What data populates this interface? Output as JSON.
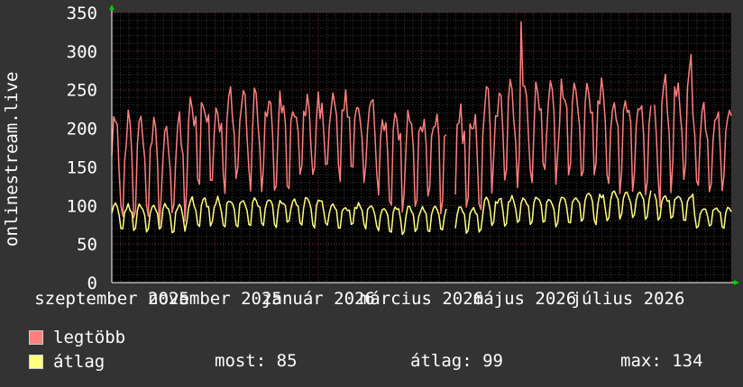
{
  "chart_data": {
    "type": "line",
    "ylabel": "onlinestream.live",
    "ylim": [
      0,
      350
    ],
    "yticks": [
      0,
      50,
      100,
      150,
      200,
      250,
      300,
      350
    ],
    "xtick_labels": [
      "szeptember 2025",
      "november 2025",
      "január 2026",
      "március 2026",
      "május 2026",
      "július 2026"
    ],
    "grid": true,
    "gaps": [
      [
        0.542,
        0.552
      ],
      [
        0.871,
        0.874
      ]
    ],
    "series": [
      {
        "name": "legtöbb",
        "color": "#ff7f7f",
        "seed": 7,
        "segments": [
          {
            "t0": 0.0,
            "t1": 0.12,
            "base": 160,
            "amp": 50,
            "spike": 20
          },
          {
            "t0": 0.12,
            "t1": 0.35,
            "base": 195,
            "amp": 45,
            "spike": 25
          },
          {
            "t0": 0.35,
            "t1": 0.43,
            "base": 200,
            "amp": 40,
            "spike": 15
          },
          {
            "t0": 0.43,
            "t1": 0.6,
            "base": 175,
            "amp": 45,
            "spike": 20
          },
          {
            "t0": 0.6,
            "t1": 0.72,
            "base": 205,
            "amp": 45,
            "spike": 25
          },
          {
            "t0": 0.72,
            "t1": 0.8,
            "base": 210,
            "amp": 45,
            "spike": 20
          },
          {
            "t0": 0.8,
            "t1": 0.88,
            "base": 195,
            "amp": 45,
            "spike": 15
          },
          {
            "t0": 0.88,
            "t1": 0.94,
            "base": 210,
            "amp": 60,
            "spike": 35
          },
          {
            "t0": 0.94,
            "t1": 1.0,
            "base": 185,
            "amp": 40,
            "spike": 15
          }
        ],
        "max_value": 338
      },
      {
        "name": "átlag",
        "color": "#ffff80",
        "seed": 3,
        "segments": [
          {
            "t0": 0.0,
            "t1": 0.12,
            "base": 88,
            "amp": 14,
            "spike": 4
          },
          {
            "t0": 0.12,
            "t1": 0.35,
            "base": 95,
            "amp": 14,
            "spike": 5
          },
          {
            "t0": 0.35,
            "t1": 0.43,
            "base": 90,
            "amp": 12,
            "spike": 4
          },
          {
            "t0": 0.43,
            "t1": 0.6,
            "base": 85,
            "amp": 13,
            "spike": 4
          },
          {
            "t0": 0.6,
            "t1": 0.72,
            "base": 97,
            "amp": 14,
            "spike": 5
          },
          {
            "t0": 0.72,
            "t1": 0.8,
            "base": 100,
            "amp": 15,
            "spike": 5
          },
          {
            "t0": 0.8,
            "t1": 0.88,
            "base": 105,
            "amp": 14,
            "spike": 4
          },
          {
            "t0": 0.88,
            "t1": 0.94,
            "base": 102,
            "amp": 14,
            "spike": 5
          },
          {
            "t0": 0.94,
            "t1": 1.0,
            "base": 88,
            "amp": 11,
            "spike": 3
          }
        ],
        "stats": {
          "most": 85,
          "atlag": 99,
          "max": 134
        }
      }
    ]
  },
  "legend": {
    "items": [
      {
        "label": "legtöbb",
        "color": "#ff7f7f"
      },
      {
        "label": "átlag",
        "color": "#ffff80"
      }
    ]
  },
  "stats": {
    "most": "most: 85",
    "atlag": "átlag: 99",
    "max": "max: 134"
  }
}
